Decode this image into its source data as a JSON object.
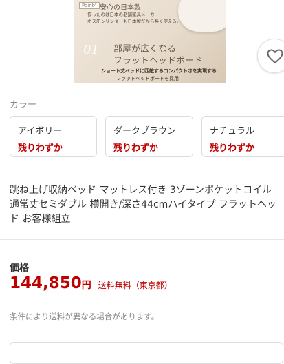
{
  "banner": {
    "point": "Point4",
    "anshin": "安心の日本製",
    "line1": "作ったのは日本の老舗家具メーカー",
    "line2": "ボス圧シリンダーも日本製だから長く使える。",
    "number": "01",
    "headline1": "部屋が広くなる",
    "headline2": "フラットヘッドボード",
    "sub1": "ショート丈ベッドに匹敵するコンパクトさを実現する",
    "sub2": "フラットヘッドボードを採用"
  },
  "favorite": {
    "icon": "heart-icon"
  },
  "color": {
    "label": "カラー",
    "options": [
      {
        "name": "アイボリー",
        "stock": "残りわずか"
      },
      {
        "name": "ダークブラウン",
        "stock": "残りわずか"
      },
      {
        "name": "ナチュラル",
        "stock": "残りわずか"
      }
    ]
  },
  "product": {
    "title": "跳ね上げ収納ベッド マットレス付き 3ゾーンポケットコイル 通常丈セミダブル 横開き/深さ44cmハイタイプ フラットヘッド お客様組立"
  },
  "price": {
    "label": "価格",
    "value": "144,850",
    "unit": "円",
    "shipping": "送料無料（東京都）",
    "condition": "条件により送料が異なる場合があります。"
  },
  "colors": {
    "accent": "#bf0000",
    "muted": "#888888",
    "border": "#dcdcdc"
  }
}
